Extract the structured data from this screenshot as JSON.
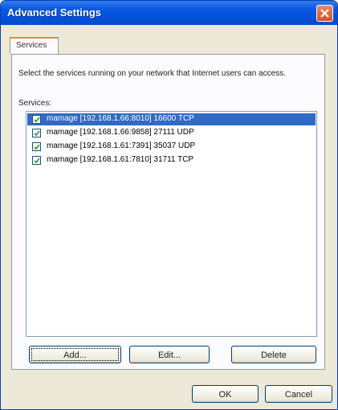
{
  "window": {
    "title": "Advanced Settings"
  },
  "tabs": [
    {
      "label": "Services"
    }
  ],
  "panel": {
    "description": "Select the services running on your network that Internet users can access.",
    "services_label": "Services:",
    "services": [
      {
        "label": "mamage [192.168.1.66:8010] 16600 TCP",
        "checked": true,
        "selected": true
      },
      {
        "label": "mamage [192.168.1.66:9858] 27111 UDP",
        "checked": true,
        "selected": false
      },
      {
        "label": "mamage [192.168.1.61:7391] 35037 UDP",
        "checked": true,
        "selected": false
      },
      {
        "label": "mamage [192.168.1.61:7810] 31711 TCP",
        "checked": true,
        "selected": false
      }
    ],
    "buttons": {
      "add": "Add...",
      "edit": "Edit...",
      "delete": "Delete"
    }
  },
  "footer": {
    "ok": "OK",
    "cancel": "Cancel"
  },
  "colors": {
    "titlebar": "#0550dc",
    "selection": "#316ac5",
    "dialog_bg": "#ece9d8"
  }
}
